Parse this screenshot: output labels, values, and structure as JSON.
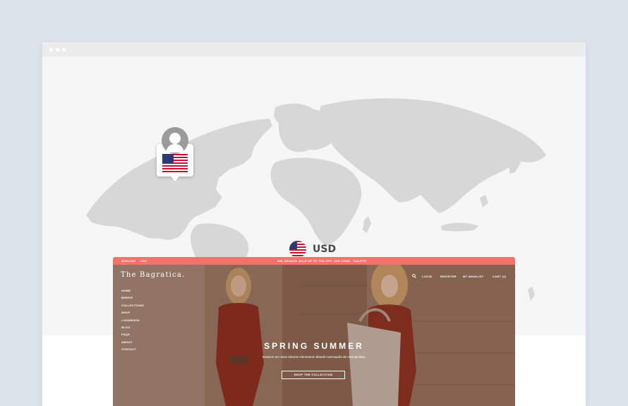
{
  "window": {
    "controls": [
      "dot",
      "dot",
      "dot"
    ]
  },
  "map": {
    "land_color": "#d7d7d7",
    "background_color": "#f6f6f6",
    "location_pin": {
      "icon": "user-avatar-icon",
      "flag": "us-flag-icon"
    }
  },
  "currency": {
    "flag": "us-flag-icon",
    "code": "USD"
  },
  "site": {
    "topbar": {
      "language": "ENGLISH",
      "currency": "USD",
      "promo": "MID-SEASON SALE UP TO 70% OFF. USE CODE: \"SALE70\"",
      "color": "#f4716c"
    },
    "logo": "The Bagratica.",
    "nav_right": [
      "LOGIN",
      "REGISTER",
      "MY WISHLIST",
      "CART (0)"
    ],
    "side_menu": [
      "HOME",
      "BREEIF",
      "COLLECTIONS",
      "SHOP",
      "LOOKBOOK",
      "BLOG",
      "FAQS",
      "ABOUT",
      "CONTACT"
    ],
    "hero": {
      "title": "SPRING SUMMER",
      "subtitle": "Donsere an marci lobortis elementum blandit cosmopolis de metropolitan.",
      "button": "SHOP THE COLLECTION"
    }
  }
}
